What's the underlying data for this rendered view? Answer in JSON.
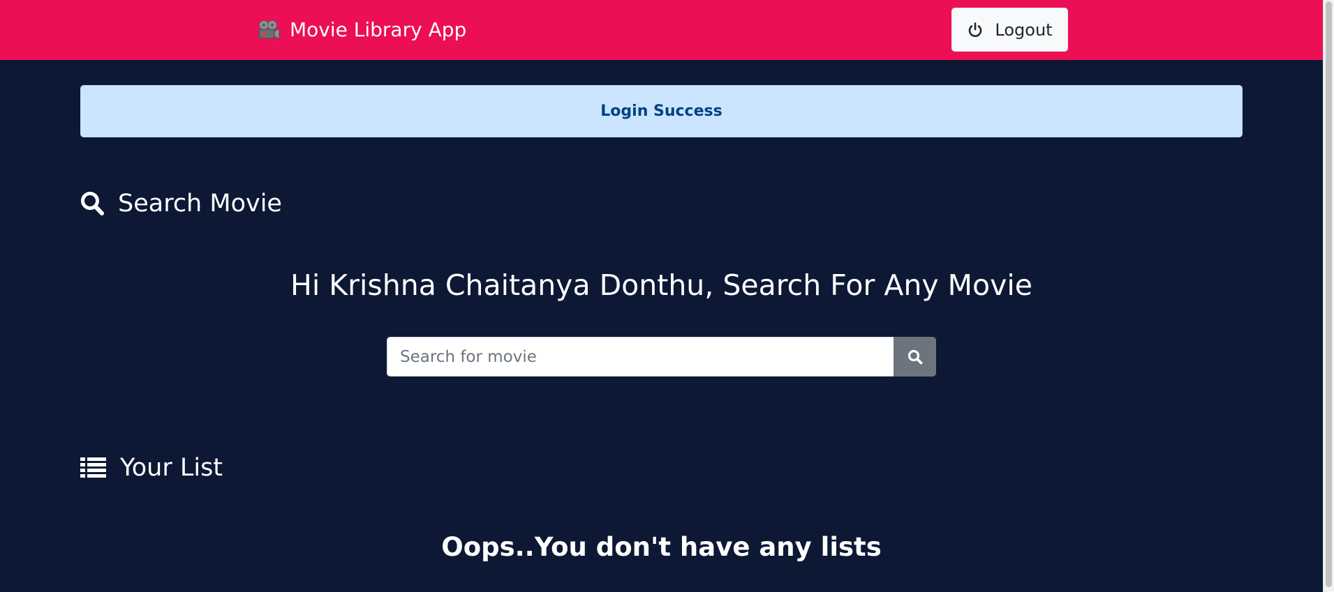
{
  "navbar": {
    "brand_icon": "film-projector-icon",
    "brand_text": "Movie Library App",
    "background": "#ec0f55",
    "logout": {
      "icon": "power-icon",
      "label": "Logout"
    }
  },
  "alert": {
    "text": "Login Success",
    "background": "#cce5ff",
    "color": "#004085"
  },
  "search_section": {
    "icon": "search-icon",
    "heading": "Search Movie",
    "greeting": "Hi Krishna Chaitanya Donthu, Search For Any Movie",
    "input": {
      "value": "",
      "placeholder": "Search for movie"
    },
    "button_icon": "search-icon"
  },
  "list_section": {
    "icon": "list-icon",
    "heading": "Your List",
    "empty_message": "Oops..You don't have any lists"
  },
  "colors": {
    "page_background": "#0d1834",
    "search_button": "#6c757d"
  }
}
